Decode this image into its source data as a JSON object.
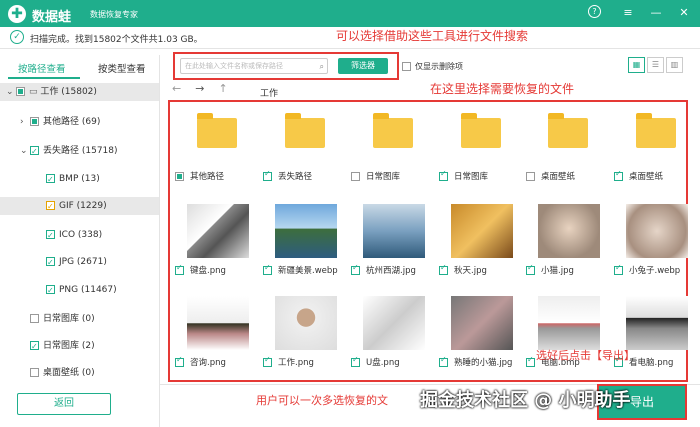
{
  "app": {
    "logo": "✚",
    "name": "数据蛙",
    "subtitle": "数据恢复专家",
    "help": "?",
    "menu": "≡",
    "minimize": "—",
    "close": "✕"
  },
  "status": {
    "text": "扫描完成。找到15802个文件共1.03 GB。"
  },
  "sidebar": {
    "tabs": [
      "按路径查看",
      "按类型查看"
    ],
    "tree": [
      {
        "label": "工作 (15802)"
      },
      {
        "label": "其他路径 (69)"
      },
      {
        "label": "丢失路径 (15718)"
      },
      {
        "label": "BMP (13)"
      },
      {
        "label": "GIF (1229)"
      },
      {
        "label": "ICO (338)"
      },
      {
        "label": "JPG (2671)"
      },
      {
        "label": "PNG (11467)"
      },
      {
        "label": "日常图库 (0)"
      },
      {
        "label": "日常图库 (2)"
      },
      {
        "label": "桌面壁纸 (0)"
      }
    ],
    "back": "返回"
  },
  "toolbar": {
    "search_placeholder": "在此处输入文件名称或保存路径",
    "filter": "筛选器",
    "show_deleted": "仅显示删除项",
    "path": "工作"
  },
  "files": [
    {
      "name": "其他路径",
      "type": "folder"
    },
    {
      "name": "丢失路径",
      "type": "folder"
    },
    {
      "name": "日常图库",
      "type": "folder"
    },
    {
      "name": "日常图库",
      "type": "folder"
    },
    {
      "name": "桌面壁纸",
      "type": "folder"
    },
    {
      "name": "桌面壁纸",
      "type": "folder"
    },
    {
      "name": "键盘.png",
      "type": "image"
    },
    {
      "name": "新疆美景.webp",
      "type": "image"
    },
    {
      "name": "杭州西湖.jpg",
      "type": "image"
    },
    {
      "name": "秋天.jpg",
      "type": "image"
    },
    {
      "name": "小猫.jpg",
      "type": "image"
    },
    {
      "name": "小兔子.webp",
      "type": "image"
    },
    {
      "name": "咨询.png",
      "type": "image"
    },
    {
      "name": "工作.png",
      "type": "image"
    },
    {
      "name": "U盘.png",
      "type": "image"
    },
    {
      "name": "熟睡的小猫.jpg",
      "type": "image"
    },
    {
      "name": "电脑.bmp",
      "type": "image"
    },
    {
      "name": "看电脑.png",
      "type": "image"
    }
  ],
  "annotations": {
    "search_tip": "可以选择借助这些工具进行文件搜索",
    "select_tip": "在这里选择需要恢复的文件",
    "export_tip": "选好后点击【导出】",
    "multi_tip": "用户可以一次多选恢复的文"
  },
  "export": "导出",
  "watermark": "掘金技术社区 @ 小明助手",
  "colors": {
    "accent": "#1fae8c",
    "annotation": "#e53935",
    "folder": "#f7c948"
  }
}
